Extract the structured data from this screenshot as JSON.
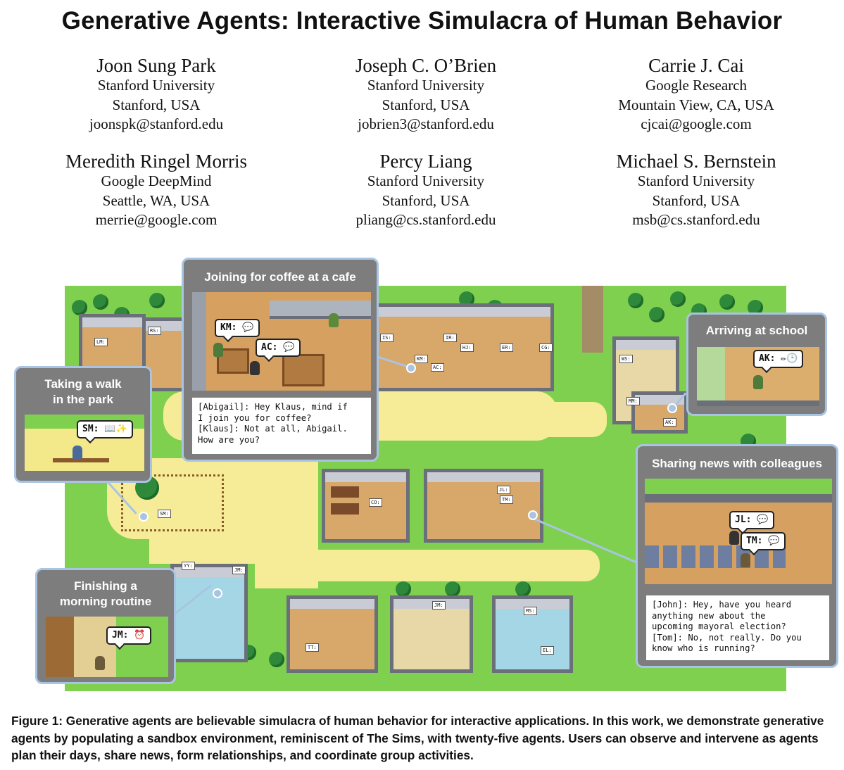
{
  "paper": {
    "title": "Generative Agents: Interactive Simulacra of Human Behavior",
    "authors": [
      {
        "name": "Joon Sung Park",
        "affiliation": "Stanford University",
        "location": "Stanford, USA",
        "email": "joonspk@stanford.edu"
      },
      {
        "name": "Joseph C. O’Brien",
        "affiliation": "Stanford University",
        "location": "Stanford, USA",
        "email": "jobrien3@stanford.edu"
      },
      {
        "name": "Carrie J. Cai",
        "affiliation": "Google Research",
        "location": "Mountain View, CA, USA",
        "email": "cjcai@google.com"
      },
      {
        "name": "Meredith Ringel Morris",
        "affiliation": "Google DeepMind",
        "location": "Seattle, WA, USA",
        "email": "merrie@google.com"
      },
      {
        "name": "Percy Liang",
        "affiliation": "Stanford University",
        "location": "Stanford, USA",
        "email": "pliang@cs.stanford.edu"
      },
      {
        "name": "Michael S. Bernstein",
        "affiliation": "Stanford University",
        "location": "Stanford, USA",
        "email": "msb@cs.stanford.edu"
      }
    ]
  },
  "figure": {
    "callouts": {
      "cafe": {
        "title": "Joining for coffee at a cafe",
        "bubbles": [
          "KM: 💬",
          "AC: 💬"
        ],
        "dialog": "[Abigail]: Hey Klaus, mind if\nI join you for coffee?\n[Klaus]: Not at all, Abigail.\nHow are you?"
      },
      "park": {
        "title": "Taking a walk\nin the park",
        "bubbles": [
          "SM: 📖✨"
        ]
      },
      "school": {
        "title": "Arriving at school",
        "bubbles": [
          "AK: ✏🕒"
        ]
      },
      "colleagues": {
        "title": "Sharing news with colleagues",
        "bubbles": [
          "JL: 💬",
          "TM: 💬"
        ],
        "dialog": "[John]: Hey, have you heard\nanything new about the\nupcoming mayoral election?\n[Tom]: No, not really. Do you\nknow who is running?"
      },
      "morning": {
        "title": "Finishing a\nmorning routine",
        "bubbles": [
          "JM: ⏰"
        ]
      }
    },
    "map_tags": [
      "RS:",
      "LM:",
      "IS:",
      "IR:",
      "HJ:",
      "KM:",
      "AC:",
      "ER:",
      "CG:",
      "WS:",
      "MM:",
      "AK:",
      "CO:",
      "JL:",
      "TM:",
      "SM:",
      "YY:",
      "JM:",
      "JM:",
      "MS:",
      "TT:",
      "EL:"
    ],
    "caption": "Figure 1: Generative agents are believable simulacra of human behavior for interactive applications. In this work, we demonstrate generative agents by populating a sandbox environment, reminiscent of The Sims, with twenty-five agents. Users can observe and intervene as agents plan their days, share news, form relationships, and coordinate group activities."
  },
  "colors": {
    "grass": "#7fd04e",
    "path": "#f6ec98",
    "callout_bg": "#7d7d7d",
    "callout_border": "#a9c4e2",
    "wall": "#6b6f7a",
    "floor": "#d8a86a"
  }
}
